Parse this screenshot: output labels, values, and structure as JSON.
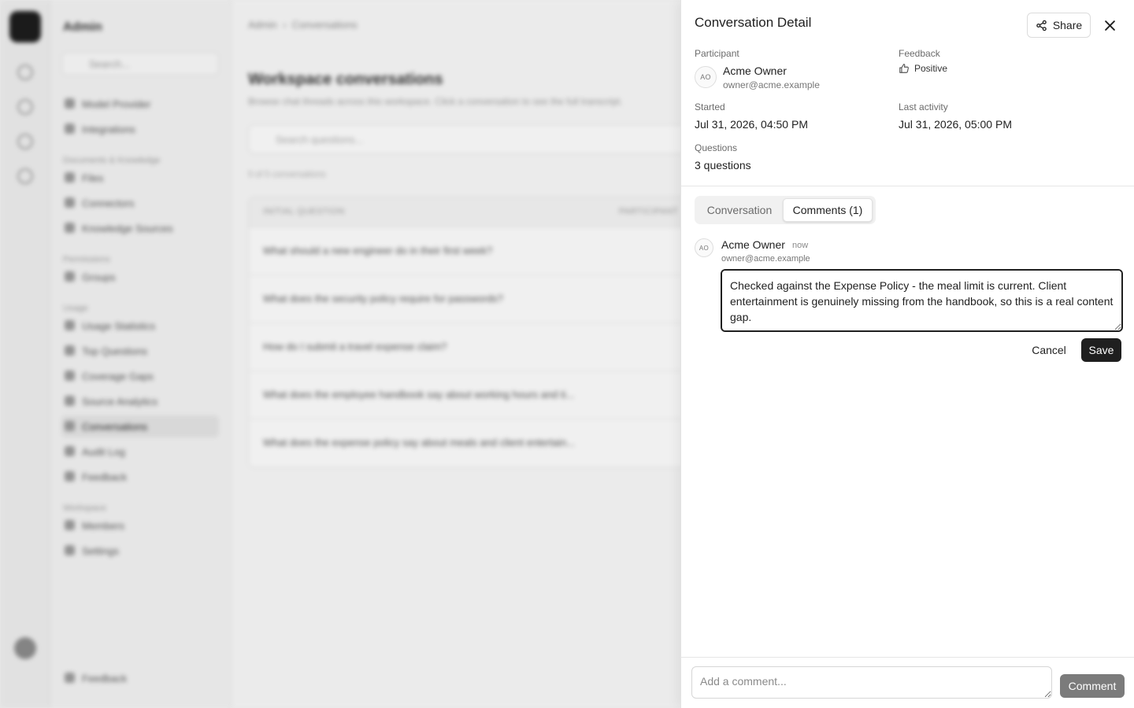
{
  "background": {
    "brand": "Admin",
    "search_placeholder": "Search...",
    "nav": [
      {
        "type": "item",
        "label": "Model Provider"
      },
      {
        "type": "item",
        "label": "Integrations"
      },
      {
        "type": "section",
        "label": "Documents & Knowledge"
      },
      {
        "type": "item",
        "label": "Files"
      },
      {
        "type": "item",
        "label": "Connectors"
      },
      {
        "type": "item",
        "label": "Knowledge Sources"
      },
      {
        "type": "section",
        "label": "Permissions"
      },
      {
        "type": "item",
        "label": "Groups"
      },
      {
        "type": "section",
        "label": "Usage"
      },
      {
        "type": "item",
        "label": "Usage Statistics"
      },
      {
        "type": "item",
        "label": "Top Questions"
      },
      {
        "type": "item",
        "label": "Coverage Gaps"
      },
      {
        "type": "item",
        "label": "Source Analytics"
      },
      {
        "type": "item",
        "label": "Conversations",
        "active": true
      },
      {
        "type": "item",
        "label": "Audit Log"
      },
      {
        "type": "item",
        "label": "Feedback"
      },
      {
        "type": "section",
        "label": "Workspace"
      },
      {
        "type": "item",
        "label": "Members"
      },
      {
        "type": "item",
        "label": "Settings"
      }
    ],
    "footer_nav": "Feedback",
    "breadcrumb": [
      "Admin",
      "Conversations"
    ],
    "page_title": "Workspace conversations",
    "page_subtitle": "Browse chat threads across this workspace. Click a conversation to see the full transcript.",
    "search_placeholder_main": "Search questions...",
    "count_text": "5 of 5 conversations",
    "table_headers": [
      "INITIAL QUESTION",
      "PARTICIPANT"
    ],
    "rows": [
      "What should a new engineer do in their first week?",
      "What does the security policy require for passwords?",
      "How do I submit a travel expense claim?",
      "What does the employee handbook say about working hours and ti...",
      "What does the expense policy say about meals and client entertain..."
    ]
  },
  "drawer": {
    "title": "Conversation Detail",
    "share_label": "Share",
    "participant": {
      "label": "Participant",
      "initials": "AO",
      "name": "Acme Owner",
      "email": "owner@acme.example"
    },
    "feedback": {
      "label": "Feedback",
      "value": "Positive"
    },
    "started": {
      "label": "Started",
      "value": "Jul 31, 2026, 04:50 PM"
    },
    "last_activity": {
      "label": "Last activity",
      "value": "Jul 31, 2026, 05:00 PM"
    },
    "questions": {
      "label": "Questions",
      "value": "3 questions"
    },
    "tabs": [
      {
        "label": "Conversation",
        "active": false
      },
      {
        "label": "Comments (1)",
        "active": true
      }
    ],
    "comment": {
      "initials": "AO",
      "author": "Acme Owner",
      "time": "now",
      "email": "owner@acme.example",
      "edit_text": "Checked against the Expense Policy - the meal limit is current. Client entertainment is genuinely missing from the handbook, so this is a real content gap.",
      "cancel_label": "Cancel",
      "save_label": "Save"
    },
    "composer": {
      "placeholder": "Add a comment...",
      "submit_label": "Comment"
    }
  }
}
